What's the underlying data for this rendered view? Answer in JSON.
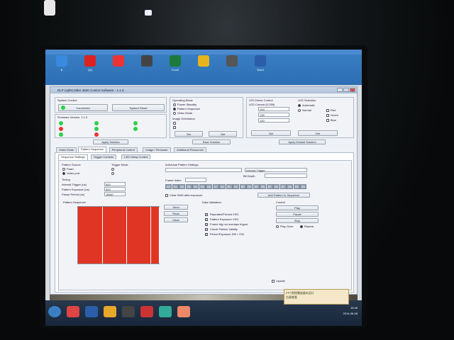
{
  "desktop_icons": [
    {
      "label": "$",
      "color": "#3a8ae0"
    },
    {
      "label": "QQ",
      "color": "#d22"
    },
    {
      "label": "",
      "color": "#e33"
    },
    {
      "label": "",
      "color": "#444"
    },
    {
      "label": "Excel",
      "color": "#1d7a3c"
    },
    {
      "label": "",
      "color": "#e7b41d"
    },
    {
      "label": "",
      "color": "#555"
    },
    {
      "label": "Word",
      "color": "#2b5da8"
    }
  ],
  "window": {
    "title": "DLP LightCrafter 4500 Control Software - 1.1.0"
  },
  "system_control": {
    "title": "System Control",
    "connected_label": "Connected",
    "reset_label": "System Reset"
  },
  "firmware": {
    "title": "Firmware Version: 1.1.0"
  },
  "operating_mode": {
    "title": "Operating Mode",
    "options": [
      "Power Standby",
      "Pattern Sequence",
      "Video Mode"
    ],
    "image_orientation": "Image Orientation"
  },
  "led_driver": {
    "title": "LED Driver Control",
    "current_label": "LED Current (0-255)",
    "red": "104",
    "green": "135",
    "blue": "130",
    "selection_title": "LED Selection",
    "automatic": "Automatic",
    "normal": "Normal",
    "red_cb": "Red",
    "green_cb": "Green",
    "blue_cb": "Blue"
  },
  "buttons": {
    "set": "Set",
    "get": "Get",
    "apply": "Apply Solution",
    "save": "Save Solution",
    "apply_default": "Apply Default Solution"
  },
  "tabs": [
    "Video Mode",
    "Pattern Sequence",
    "Peripheral Control",
    "Image / Firmware",
    "Additional Resources"
  ],
  "subtabs": [
    "Sequence Settings",
    "Trigger Controls",
    "LED Delay Control"
  ],
  "pattern_source": {
    "title": "Pattern Source",
    "flash": "Flash",
    "video": "Video port"
  },
  "trigger_mode": {
    "title": "Trigger Mode"
  },
  "timing": {
    "title": "Timing",
    "internal": "Internal Trigger (us)",
    "exposure": "Pattern Exposure (us)",
    "period": "Pause Period (us)",
    "internal_val": "500",
    "exposure_val": "500",
    "period_val": "16667"
  },
  "indiv": {
    "title": "Individual Pattern Settings",
    "trigger": "Internal Trigger",
    "bit_depth": "Bit Depth",
    "frame_index": "Frame Index",
    "bits": [
      "G0",
      "G1",
      "G2",
      "G3",
      "G4",
      "G5",
      "G6",
      "G7",
      "R0",
      "R1",
      "R2",
      "R3",
      "R4",
      "R5",
      "R6",
      "R7",
      "B0",
      "B1",
      "B2",
      "B3",
      "B4"
    ],
    "add": "Add Pattern to Sequence",
    "clear_dmd": "Clear DMD after exposure"
  },
  "seq": {
    "title": "Pattern Sequence",
    "cells": [
      "",
      "",
      "",
      ""
    ]
  },
  "seq_buttons": {
    "send": "Send",
    "read": "Read",
    "clear": "Clear"
  },
  "full_pattern": {
    "title": "Data Validation",
    "items": [
      "Repeated/Forced VSG",
      "Pattern Exposure VSG",
      "Frame trig not overlaps trigout",
      "Check Pattern Validity",
      "Period Exposure Diff < 230"
    ]
  },
  "control": {
    "title": "Control",
    "play": "Play",
    "pause": "Pause",
    "stop": "Stop",
    "play_once": "Play Once",
    "repeat": "Repeat",
    "update": "Update"
  },
  "notification": {
    "line1": "PPT视频播放器未运行",
    "line2": "右键查看",
    "time": "15:48",
    "date": "2014-06-08"
  }
}
